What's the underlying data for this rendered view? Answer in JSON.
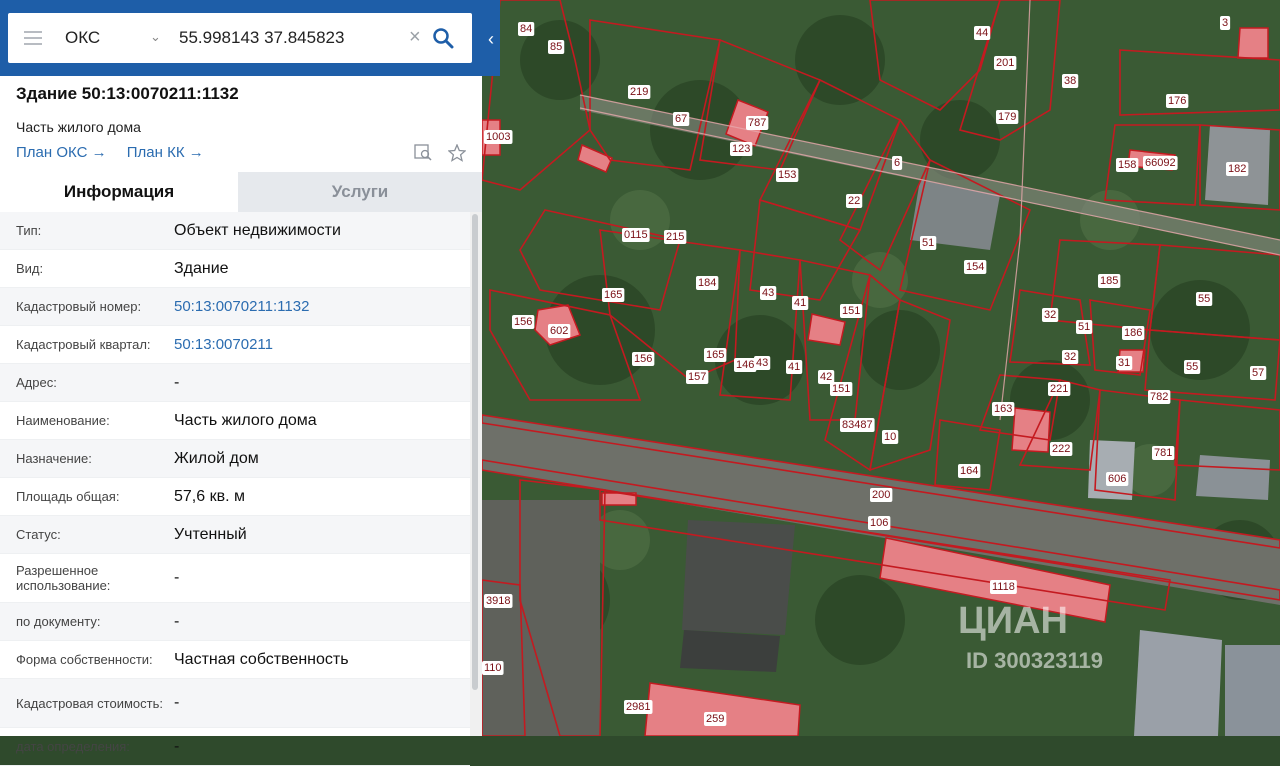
{
  "search": {
    "type_value": "ОКС",
    "query_value": "55.998143 37.845823"
  },
  "object": {
    "title": "Здание 50:13:0070211:1132",
    "subtitle": "Часть жилого дома",
    "links": [
      "План ОКС",
      "План КК"
    ]
  },
  "tabs": [
    {
      "label": "Информация",
      "active": true
    },
    {
      "label": "Услуги",
      "active": false
    }
  ],
  "info_rows": [
    {
      "label": "Тип:",
      "value": "Объект недвижимости"
    },
    {
      "label": "Вид:",
      "value": "Здание"
    },
    {
      "label": "Кадастровый номер:",
      "value": "50:13:0070211:1132",
      "link": true
    },
    {
      "label": "Кадастровый квартал:",
      "value": "50:13:0070211",
      "link": true
    },
    {
      "label": "Адрес:",
      "value": "-"
    },
    {
      "label": "Наименование:",
      "value": "Часть жилого дома"
    },
    {
      "label": "Назначение:",
      "value": "Жилой дом"
    },
    {
      "label": "Площадь общая:",
      "value": "57,6 кв. м"
    },
    {
      "label": "Статус:",
      "value": "Учтенный"
    },
    {
      "label": "Разрешенное использование:",
      "value": "-"
    },
    {
      "label": "по документу:",
      "value": "-"
    },
    {
      "label": "Форма собственности:",
      "value": "Частная собственность"
    },
    {
      "label": "Кадастровая стоимость:",
      "value": "-"
    },
    {
      "label": "дата определения:",
      "value": "-"
    }
  ],
  "map_labels": [
    "84",
    "85",
    "219",
    "67",
    "787",
    "123",
    "153",
    "6",
    "22",
    "51",
    "154",
    "44",
    "201",
    "38",
    "179",
    "176",
    "3",
    "158",
    "66092",
    "182",
    "1003",
    "0115",
    "215",
    "184",
    "165",
    "43",
    "41",
    "151",
    "185",
    "55",
    "156",
    "602",
    "156",
    "165",
    "146",
    "43",
    "157",
    "41",
    "42",
    "151",
    "83487",
    "10",
    "32",
    "51",
    "32",
    "186",
    "31",
    "55",
    "57",
    "782",
    "163",
    "221",
    "222",
    "606",
    "781",
    "164",
    "200",
    "106",
    "1118",
    "3918",
    "110",
    "2981",
    "259"
  ],
  "watermark": {
    "brand": "ЦИАН",
    "id_text": "ID 300323119"
  },
  "colors": {
    "header": "#1e5ea8",
    "link": "#2b6cb0",
    "parcel_line": "#c41a20",
    "building_fill": "#e58085"
  }
}
